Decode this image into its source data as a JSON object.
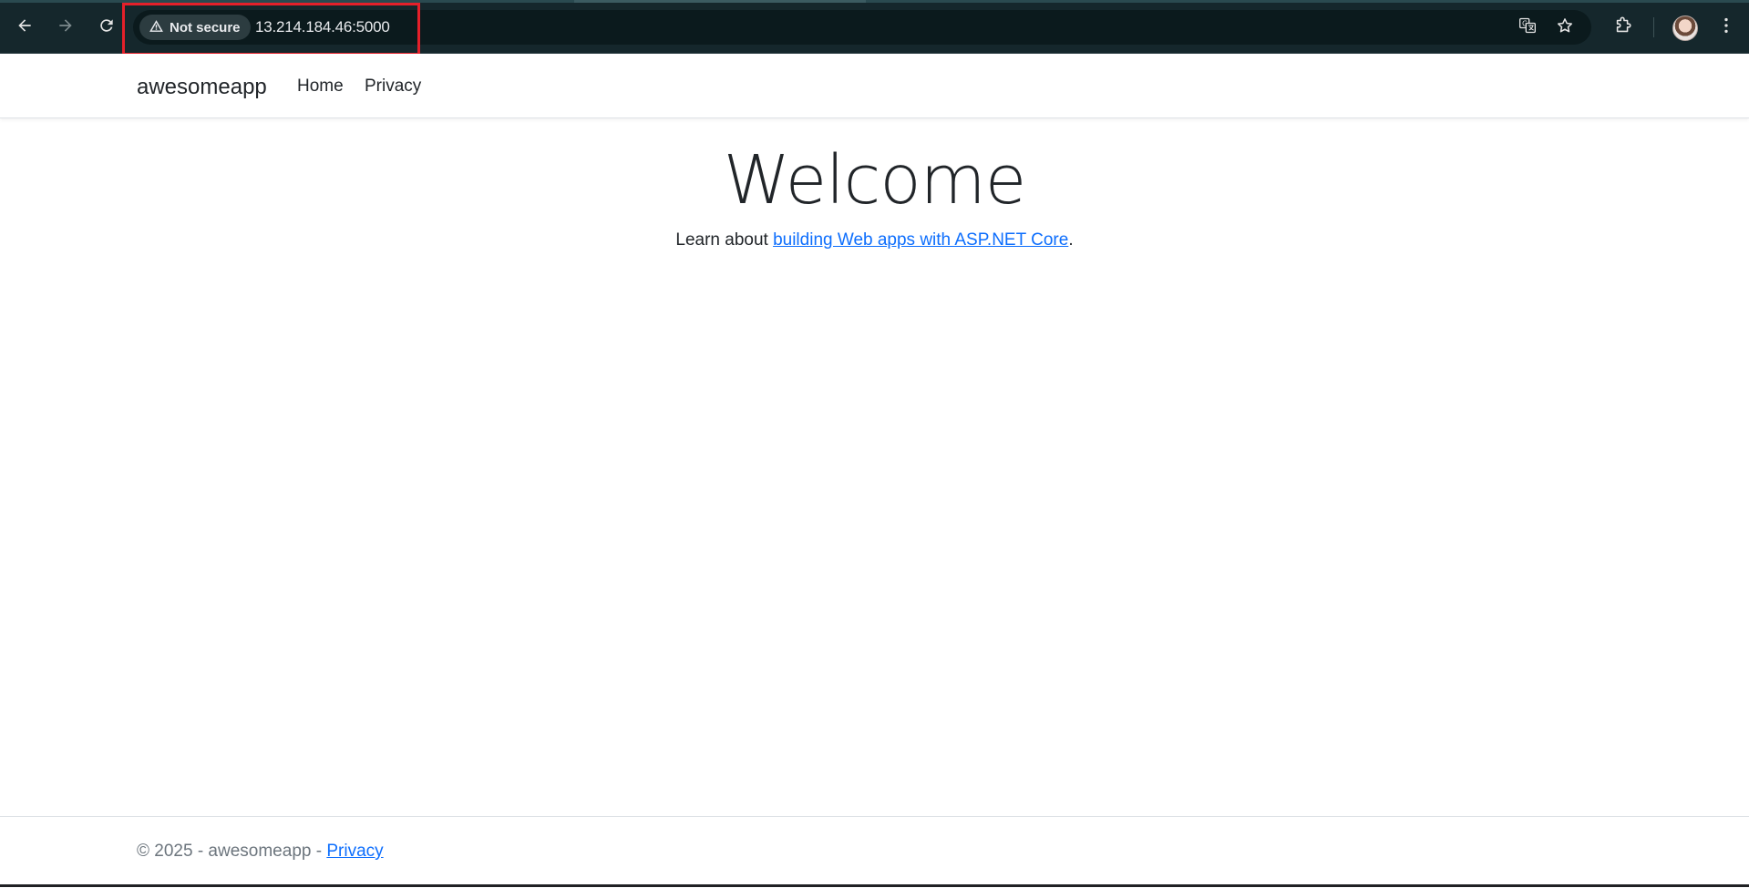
{
  "browser": {
    "security_label": "Not secure",
    "url": "13.214.184.46:5000",
    "icons": {
      "back": "back-arrow-icon",
      "forward": "forward-arrow-icon",
      "reload": "reload-icon",
      "warning": "warning-triangle-icon",
      "translate": "translate-icon",
      "bookmark": "star-icon",
      "extensions": "puzzle-icon",
      "profile": "avatar",
      "menu": "kebab-menu-icon"
    },
    "colors": {
      "toolbar": "#15272c",
      "omnibox": "#0b1a1d",
      "highlight": "#e5202a"
    }
  },
  "navbar": {
    "brand": "awesomeapp",
    "links": [
      {
        "label": "Home"
      },
      {
        "label": "Privacy"
      }
    ]
  },
  "main": {
    "heading": "Welcome",
    "lead_prefix": "Learn about ",
    "lead_link": "building Web apps with ASP.NET Core",
    "lead_suffix": "."
  },
  "footer": {
    "copyright": "© 2025 - awesomeapp - ",
    "privacy_link": "Privacy"
  },
  "theme": {
    "link": "#0d6efd",
    "text": "#212529",
    "muted": "#6c757d"
  }
}
